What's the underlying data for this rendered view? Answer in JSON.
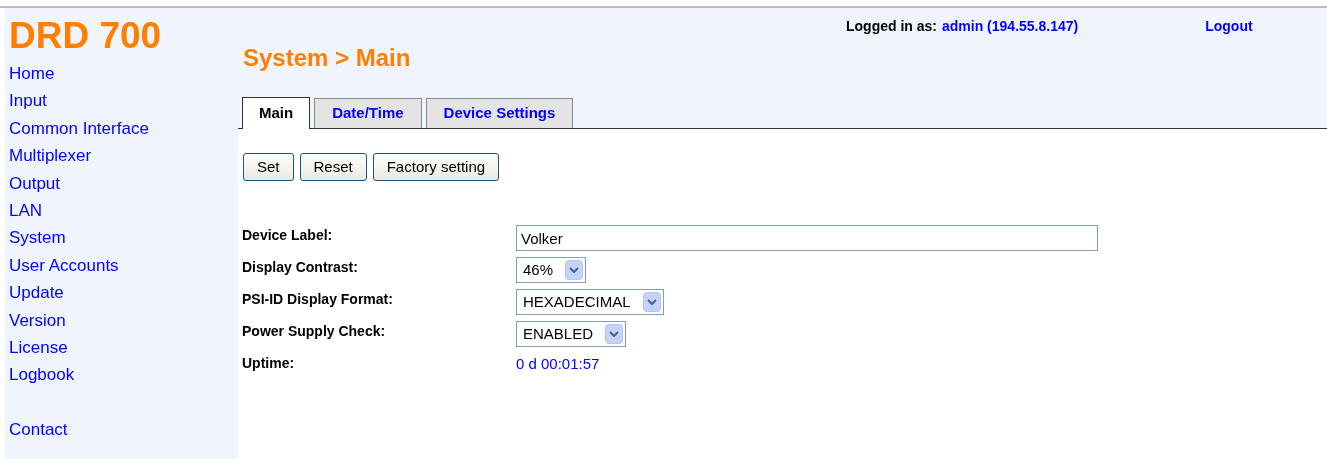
{
  "logo": "DRD 700",
  "sidebar": {
    "items": [
      {
        "label": "Home"
      },
      {
        "label": "Input"
      },
      {
        "label": "Common Interface"
      },
      {
        "label": "Multiplexer"
      },
      {
        "label": "Output"
      },
      {
        "label": "LAN"
      },
      {
        "label": "System"
      },
      {
        "label": "User Accounts"
      },
      {
        "label": "Update"
      },
      {
        "label": "Version"
      },
      {
        "label": "License"
      },
      {
        "label": "Logbook"
      }
    ],
    "footer_items": [
      {
        "label": "Contact"
      }
    ]
  },
  "login": {
    "label": "Logged in as:",
    "user": "admin (194.55.8.147)"
  },
  "logout": "Logout",
  "page_title": "System > Main",
  "tabs": [
    {
      "label": "Main",
      "selected": true
    },
    {
      "label": "Date/Time",
      "selected": false
    },
    {
      "label": "Device Settings",
      "selected": false
    }
  ],
  "buttons": [
    "Set",
    "Reset",
    "Factory setting"
  ],
  "fields": [
    {
      "kind": "text",
      "label": "Device Label:",
      "value": "Volker"
    },
    {
      "kind": "select",
      "label": "Display Contrast:",
      "value": "46%"
    },
    {
      "kind": "select",
      "label": "PSI-ID Display Format:",
      "value": "HEXADECIMAL"
    },
    {
      "kind": "select",
      "label": "Power Supply Check:",
      "value": "ENABLED"
    },
    {
      "kind": "value",
      "label": "Uptime:",
      "value": "0 d 00:01:57"
    }
  ]
}
